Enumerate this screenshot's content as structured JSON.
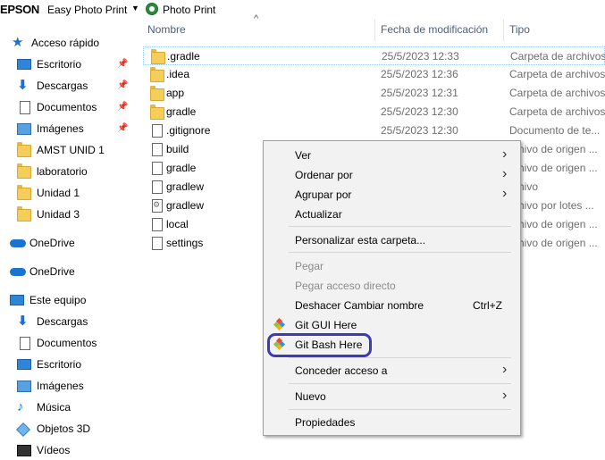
{
  "toolbar": {
    "brand": "EPSON",
    "easy_photo_print": "Easy Photo Print",
    "photo_print": "Photo Print"
  },
  "sidebar": {
    "items": [
      {
        "label": "Acceso rápido",
        "icon": "star-icon"
      },
      {
        "label": "Escritorio",
        "icon": "monitor-icon",
        "pinned": true
      },
      {
        "label": "Descargas",
        "icon": "download-icon",
        "pinned": true
      },
      {
        "label": "Documentos",
        "icon": "document-icon",
        "pinned": true
      },
      {
        "label": "Imágenes",
        "icon": "pictures-icon",
        "pinned": true
      },
      {
        "label": "AMST UNID 1",
        "icon": "folder-icon"
      },
      {
        "label": "laboratorio",
        "icon": "folder-icon"
      },
      {
        "label": "Unidad 1",
        "icon": "folder-icon"
      },
      {
        "label": "Unidad 3",
        "icon": "folder-icon"
      },
      {
        "label": "OneDrive",
        "icon": "cloud-icon"
      },
      {
        "label": "OneDrive",
        "icon": "cloud-icon"
      },
      {
        "label": "Este equipo",
        "icon": "monitor-icon"
      },
      {
        "label": "Descargas",
        "icon": "download-icon"
      },
      {
        "label": "Documentos",
        "icon": "document-icon"
      },
      {
        "label": "Escritorio",
        "icon": "monitor-icon"
      },
      {
        "label": "Imágenes",
        "icon": "pictures-icon"
      },
      {
        "label": "Música",
        "icon": "music-icon"
      },
      {
        "label": "Objetos 3D",
        "icon": "cube-icon"
      },
      {
        "label": "Vídeos",
        "icon": "video-icon"
      }
    ]
  },
  "columns": {
    "name": "Nombre",
    "date": "Fecha de modificación",
    "type": "Tipo"
  },
  "files": [
    {
      "name": ".gradle",
      "date": "25/5/2023 12:33",
      "type": "Carpeta de archivos",
      "icon": "folder-icon"
    },
    {
      "name": ".idea",
      "date": "25/5/2023 12:36",
      "type": "Carpeta de archivos",
      "icon": "folder-icon"
    },
    {
      "name": "app",
      "date": "25/5/2023 12:31",
      "type": "Carpeta de archivos",
      "icon": "folder-icon"
    },
    {
      "name": "gradle",
      "date": "25/5/2023 12:30",
      "type": "Carpeta de archivos",
      "icon": "folder-icon"
    },
    {
      "name": ".gitignore",
      "date": "25/5/2023 12:30",
      "type": "Documento de te...",
      "icon": "file-icon"
    },
    {
      "name": "build",
      "date": "",
      "type": "rchivo de origen ...",
      "icon": "file-icon"
    },
    {
      "name": "gradle",
      "date": "",
      "type": "rchivo de origen ...",
      "icon": "file-icon"
    },
    {
      "name": "gradlew",
      "date": "",
      "type": "rchivo",
      "icon": "file-icon"
    },
    {
      "name": "gradlew",
      "date": "",
      "type": "rchivo por lotes ...",
      "icon": "settings-file-icon"
    },
    {
      "name": "local",
      "date": "",
      "type": "rchivo de origen ...",
      "icon": "file-icon"
    },
    {
      "name": "settings",
      "date": "",
      "type": "rchivo de origen ...",
      "icon": "file-icon"
    }
  ],
  "context_menu": {
    "ver": "Ver",
    "ordenar": "Ordenar por",
    "agrupar": "Agrupar por",
    "actualizar": "Actualizar",
    "personalizar": "Personalizar esta carpeta...",
    "pegar": "Pegar",
    "pegar_acceso": "Pegar acceso directo",
    "deshacer": "Deshacer Cambiar nombre",
    "deshacer_shortcut": "Ctrl+Z",
    "git_gui": "Git GUI Here",
    "git_bash": "Git Bash Here",
    "conceder": "Conceder acceso a",
    "nuevo": "Nuevo",
    "propiedades": "Propiedades"
  },
  "colors": {
    "highlight_ring": "#3b3bb5",
    "selection_border": "#99c8f0"
  }
}
